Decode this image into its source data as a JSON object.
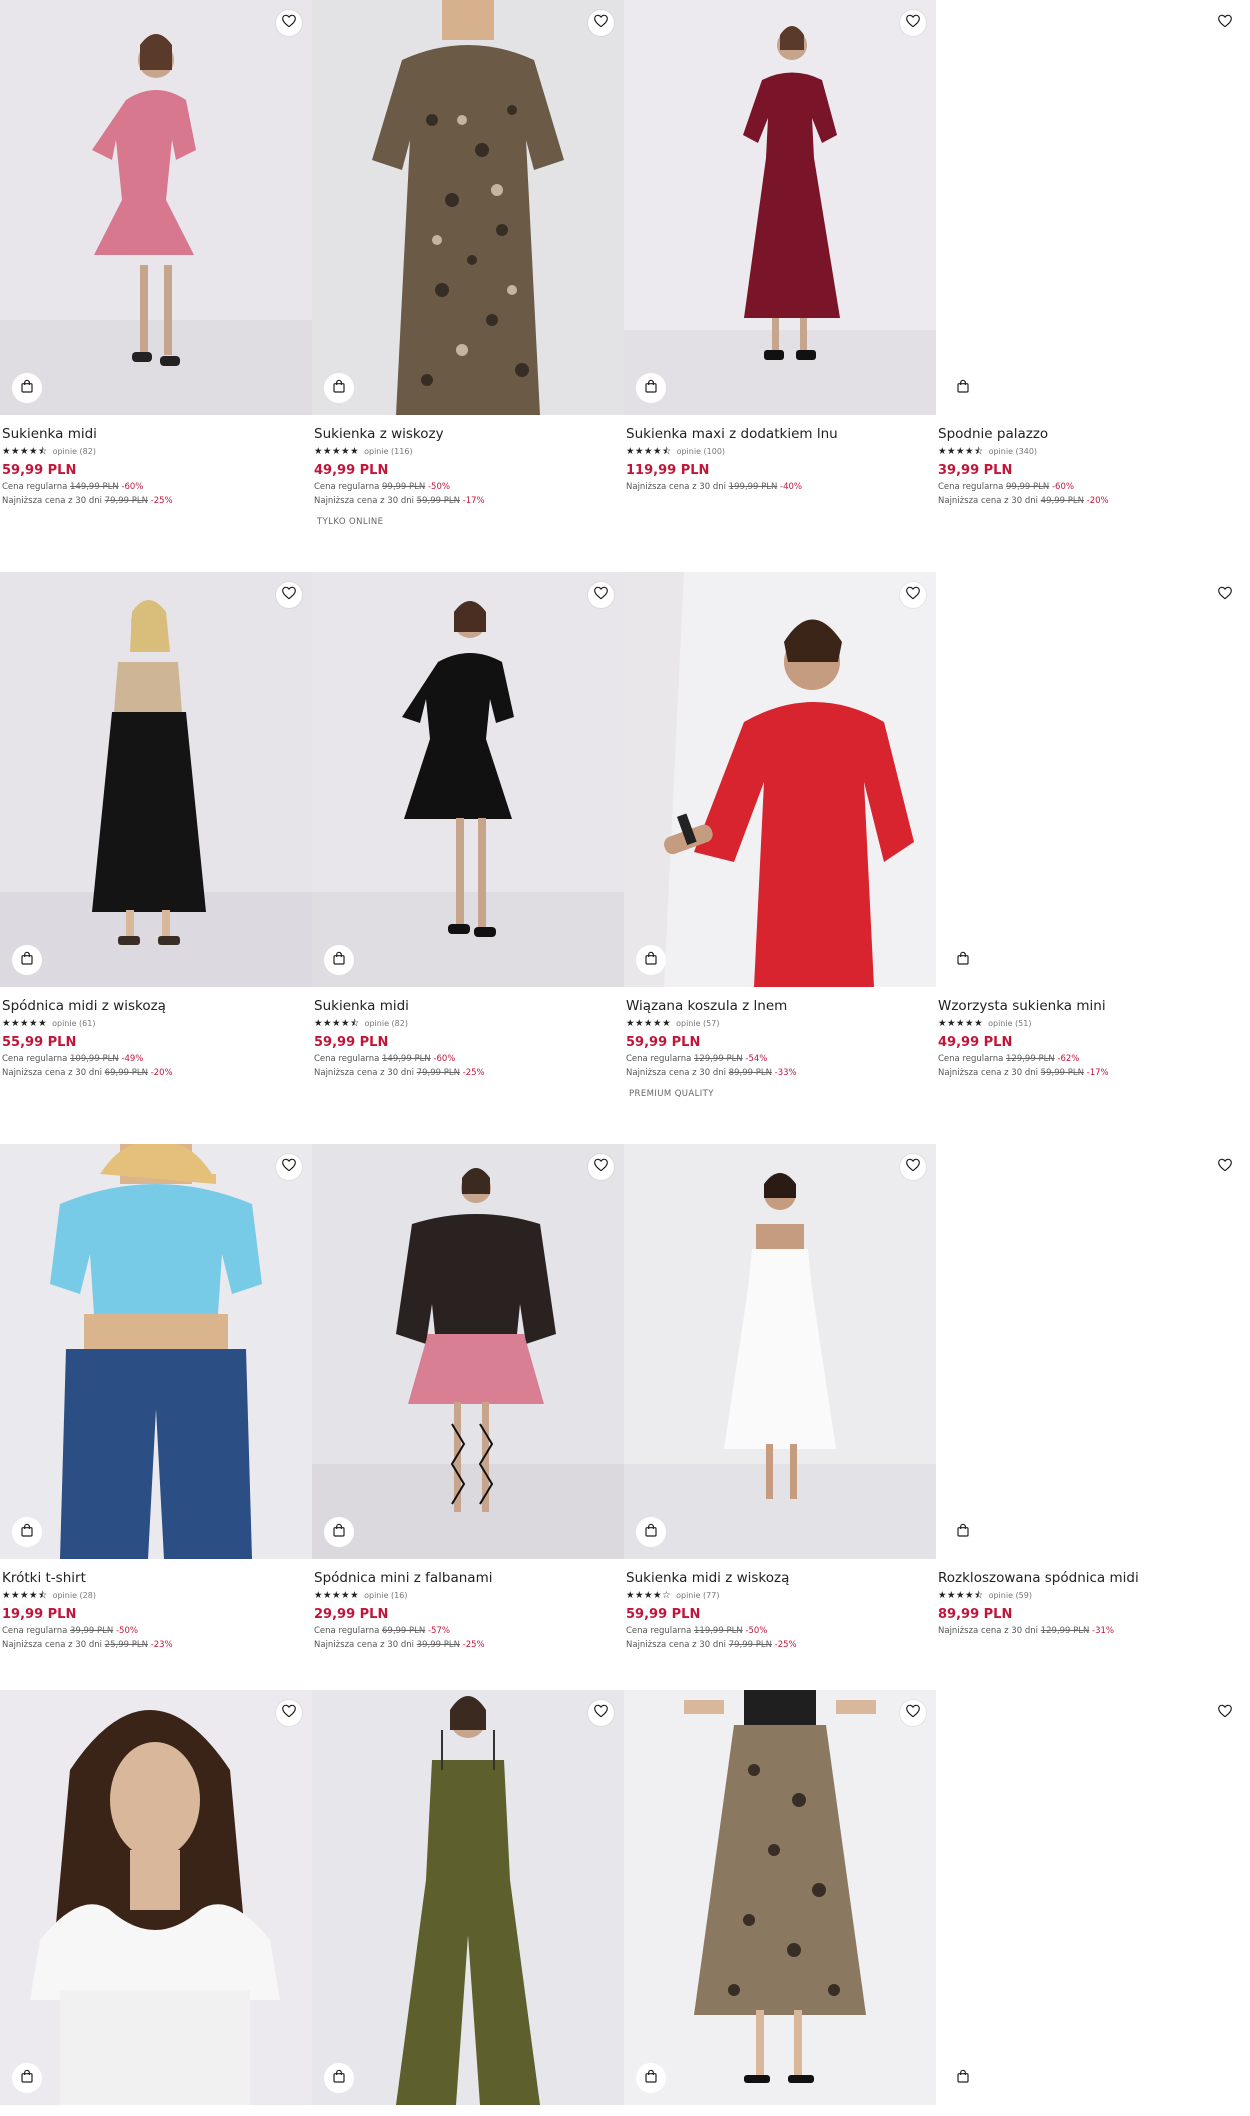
{
  "colors": {
    "price": "#c0163a",
    "discount": "#c0163a",
    "text": "#222222",
    "muted": "#777777"
  },
  "icons": {
    "favorite": "heart-outline-icon",
    "cart": "shopping-bag-icon"
  },
  "products": [
    {
      "name": "Sukienka midi",
      "stars": "★★★★⯪",
      "reviews": "opinie (82)",
      "price": "59,99 PLN",
      "regular_label": "Cena regularna",
      "regular_old": "149,99 PLN",
      "regular_disc": "-60%",
      "lowest_label": "Najniższa cena z 30 dni",
      "lowest_old": "79,99 PLN",
      "lowest_disc": "-25%",
      "badge": ""
    },
    {
      "name": "Sukienka z wiskozy",
      "stars": "★★★★★",
      "reviews": "opinie (116)",
      "price": "49,99 PLN",
      "regular_label": "Cena regularna",
      "regular_old": "99,99 PLN",
      "regular_disc": "-50%",
      "lowest_label": "Najniższa cena z 30 dni",
      "lowest_old": "59,99 PLN",
      "lowest_disc": "-17%",
      "badge": "TYLKO ONLINE"
    },
    {
      "name": "Sukienka maxi z dodatkiem lnu",
      "stars": "★★★★⯪",
      "reviews": "opinie (100)",
      "price": "119,99 PLN",
      "regular_label": "",
      "regular_old": "",
      "regular_disc": "",
      "lowest_label": "Najniższa cena z 30 dni",
      "lowest_old": "199,99 PLN",
      "lowest_disc": "-40%",
      "badge": ""
    },
    {
      "name": "Spodnie palazzo",
      "stars": "★★★★⯪",
      "reviews": "opinie (340)",
      "price": "39,99 PLN",
      "regular_label": "Cena regularna",
      "regular_old": "99,99 PLN",
      "regular_disc": "-60%",
      "lowest_label": "Najniższa cena z 30 dni",
      "lowest_old": "49,99 PLN",
      "lowest_disc": "-20%",
      "badge": ""
    },
    {
      "name": "Spódnica midi z wiskozą",
      "stars": "★★★★★",
      "reviews": "opinie (61)",
      "price": "55,99 PLN",
      "regular_label": "Cena regularna",
      "regular_old": "109,99 PLN",
      "regular_disc": "-49%",
      "lowest_label": "Najniższa cena z 30 dni",
      "lowest_old": "69,99 PLN",
      "lowest_disc": "-20%",
      "badge": ""
    },
    {
      "name": "Sukienka midi",
      "stars": "★★★★⯪",
      "reviews": "opinie (82)",
      "price": "59,99 PLN",
      "regular_label": "Cena regularna",
      "regular_old": "149,99 PLN",
      "regular_disc": "-60%",
      "lowest_label": "Najniższa cena z 30 dni",
      "lowest_old": "79,99 PLN",
      "lowest_disc": "-25%",
      "badge": ""
    },
    {
      "name": "Wiązana koszula z lnem",
      "stars": "★★★★★",
      "reviews": "opinie (57)",
      "price": "59,99 PLN",
      "regular_label": "Cena regularna",
      "regular_old": "129,99 PLN",
      "regular_disc": "-54%",
      "lowest_label": "Najniższa cena z 30 dni",
      "lowest_old": "89,99 PLN",
      "lowest_disc": "-33%",
      "badge": "PREMIUM QUALITY"
    },
    {
      "name": "Wzorzysta sukienka mini",
      "stars": "★★★★★",
      "reviews": "opinie (51)",
      "price": "49,99 PLN",
      "regular_label": "Cena regularna",
      "regular_old": "129,99 PLN",
      "regular_disc": "-62%",
      "lowest_label": "Najniższa cena z 30 dni",
      "lowest_old": "59,99 PLN",
      "lowest_disc": "-17%",
      "badge": ""
    },
    {
      "name": "Krótki t-shirt",
      "stars": "★★★★⯪",
      "reviews": "opinie (28)",
      "price": "19,99 PLN",
      "regular_label": "Cena regularna",
      "regular_old": "39,99 PLN",
      "regular_disc": "-50%",
      "lowest_label": "Najniższa cena z 30 dni",
      "lowest_old": "25,99 PLN",
      "lowest_disc": "-23%",
      "badge": ""
    },
    {
      "name": "Spódnica mini z falbanami",
      "stars": "★★★★★",
      "reviews": "opinie (16)",
      "price": "29,99 PLN",
      "regular_label": "Cena regularna",
      "regular_old": "69,99 PLN",
      "regular_disc": "-57%",
      "lowest_label": "Najniższa cena z 30 dni",
      "lowest_old": "39,99 PLN",
      "lowest_disc": "-25%",
      "badge": ""
    },
    {
      "name": "Sukienka midi z wiskozą",
      "stars": "★★★★☆",
      "reviews": "opinie (77)",
      "price": "59,99 PLN",
      "regular_label": "Cena regularna",
      "regular_old": "119,99 PLN",
      "regular_disc": "-50%",
      "lowest_label": "Najniższa cena z 30 dni",
      "lowest_old": "79,99 PLN",
      "lowest_disc": "-25%",
      "badge": ""
    },
    {
      "name": "Rozkloszowana spódnica midi",
      "stars": "★★★★⯪",
      "reviews": "opinie (59)",
      "price": "89,99 PLN",
      "regular_label": "",
      "regular_old": "",
      "regular_disc": "",
      "lowest_label": "Najniższa cena z 30 dni",
      "lowest_old": "129,99 PLN",
      "lowest_disc": "-31%",
      "badge": ""
    },
    {
      "name": "",
      "stars": "",
      "reviews": "",
      "price": "",
      "regular_label": "",
      "regular_old": "",
      "regular_disc": "",
      "lowest_label": "",
      "lowest_old": "",
      "lowest_disc": "",
      "badge": ""
    },
    {
      "name": "",
      "stars": "",
      "reviews": "",
      "price": "",
      "regular_label": "",
      "regular_old": "",
      "regular_disc": "",
      "lowest_label": "",
      "lowest_old": "",
      "lowest_disc": "",
      "badge": ""
    },
    {
      "name": "",
      "stars": "",
      "reviews": "",
      "price": "",
      "regular_label": "",
      "regular_old": "",
      "regular_disc": "",
      "lowest_label": "",
      "lowest_old": "",
      "lowest_disc": "",
      "badge": ""
    },
    {
      "name": "",
      "stars": "",
      "reviews": "",
      "price": "",
      "regular_label": "",
      "regular_old": "",
      "regular_disc": "",
      "lowest_label": "",
      "lowest_old": "",
      "lowest_disc": "",
      "badge": ""
    }
  ]
}
